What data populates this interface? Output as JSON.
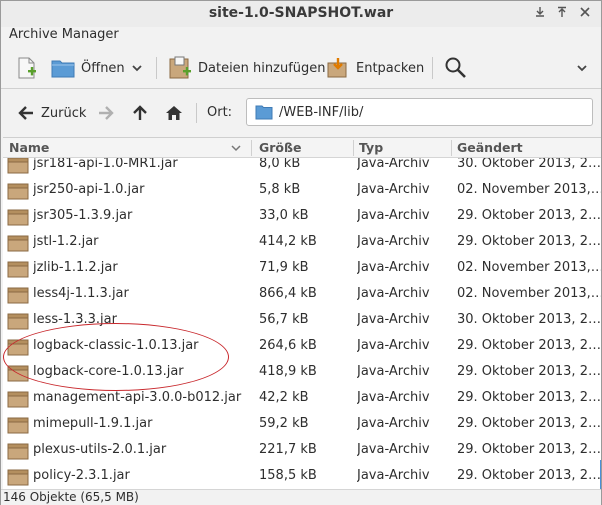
{
  "window": {
    "title": "site-1.0-SNAPSHOT.war"
  },
  "menu": {
    "archive_manager": "Archive Manager"
  },
  "toolbar": {
    "open_label": "Öffnen",
    "add_files_label": "Dateien hinzufügen",
    "extract_label": "Entpacken"
  },
  "nav": {
    "back_label": "Zurück",
    "location_label": "Ort:",
    "location_path": "/WEB-INF/lib/"
  },
  "columns": {
    "name": "Name",
    "size": "Größe",
    "type": "Typ",
    "modified": "Geändert"
  },
  "files": [
    {
      "name": "jsr181-api-1.0-MR1.jar",
      "size": "8,0 kB",
      "type": "Java-Archiv",
      "modified": "30. Oktober 2013, 2…"
    },
    {
      "name": "jsr250-api-1.0.jar",
      "size": "5,8 kB",
      "type": "Java-Archiv",
      "modified": "02. November 2013,…"
    },
    {
      "name": "jsr305-1.3.9.jar",
      "size": "33,0 kB",
      "type": "Java-Archiv",
      "modified": "29. Oktober 2013, 2…"
    },
    {
      "name": "jstl-1.2.jar",
      "size": "414,2 kB",
      "type": "Java-Archiv",
      "modified": "29. Oktober 2013, 2…"
    },
    {
      "name": "jzlib-1.1.2.jar",
      "size": "71,9 kB",
      "type": "Java-Archiv",
      "modified": "02. November 2013,…"
    },
    {
      "name": "less4j-1.1.3.jar",
      "size": "866,4 kB",
      "type": "Java-Archiv",
      "modified": "02. November 2013,…"
    },
    {
      "name": "less-1.3.3.jar",
      "size": "56,7 kB",
      "type": "Java-Archiv",
      "modified": "30. Oktober 2013, 2…"
    },
    {
      "name": "logback-classic-1.0.13.jar",
      "size": "264,6 kB",
      "type": "Java-Archiv",
      "modified": "29. Oktober 2013, 2…"
    },
    {
      "name": "logback-core-1.0.13.jar",
      "size": "418,9 kB",
      "type": "Java-Archiv",
      "modified": "29. Oktober 2013, 2…"
    },
    {
      "name": "management-api-3.0.0-b012.jar",
      "size": "42,2 kB",
      "type": "Java-Archiv",
      "modified": "29. Oktober 2013, 2…"
    },
    {
      "name": "mimepull-1.9.1.jar",
      "size": "59,2 kB",
      "type": "Java-Archiv",
      "modified": "29. Oktober 2013, 2…"
    },
    {
      "name": "plexus-utils-2.0.1.jar",
      "size": "221,7 kB",
      "type": "Java-Archiv",
      "modified": "29. Oktober 2013, 2…"
    },
    {
      "name": "policy-2.3.1.jar",
      "size": "158,5 kB",
      "type": "Java-Archiv",
      "modified": "29. Oktober 2013, 2…"
    }
  ],
  "status": {
    "summary": "146 Objekte (65,5 MB)"
  },
  "colors": {
    "annotation": "#c8282d",
    "folder": "#5b9bd5",
    "jar": "#c9a77c"
  }
}
